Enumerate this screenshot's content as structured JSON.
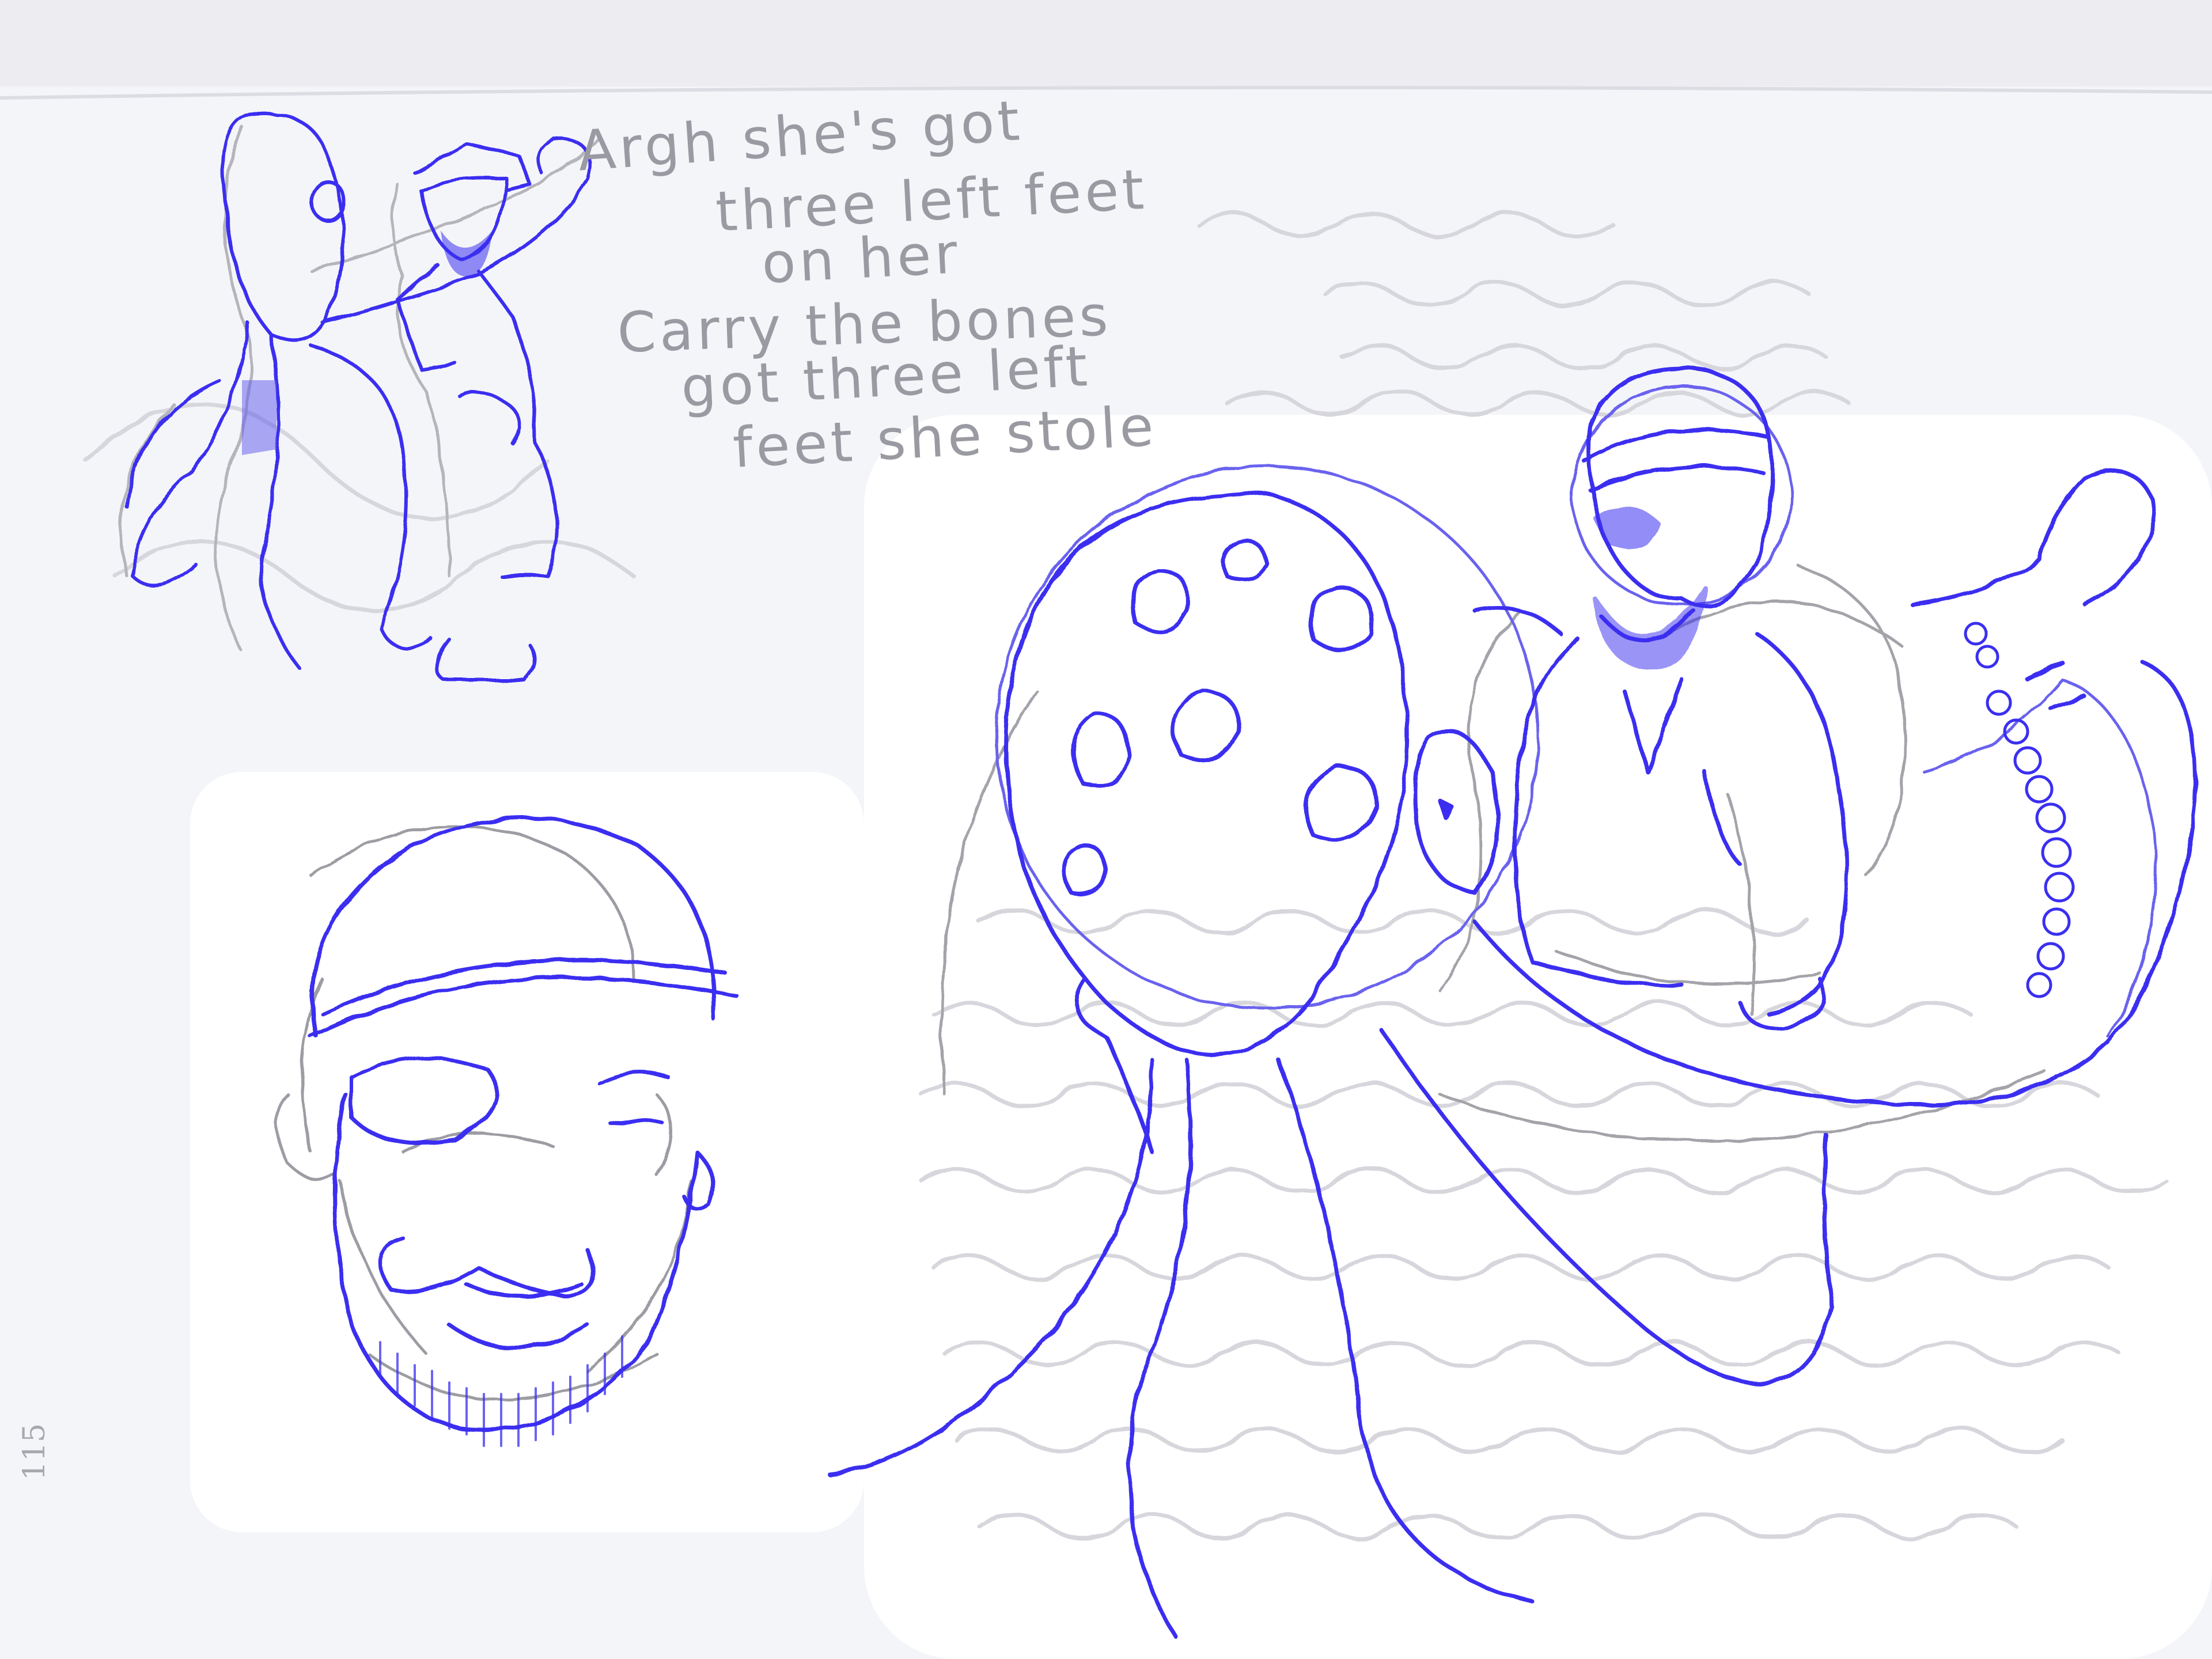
{
  "handwriting": {
    "line_1": "Argh she's got",
    "line_2": "three left feet",
    "line_3": "on her",
    "line_4": "Carry the bones",
    "line_5": "got three left",
    "line_6": "feet she stole"
  },
  "page_number": "115",
  "colors": {
    "paper": "#f4f5f9",
    "blue_pencil": "#3a2ff0",
    "graphite": "#a3a3a9"
  }
}
